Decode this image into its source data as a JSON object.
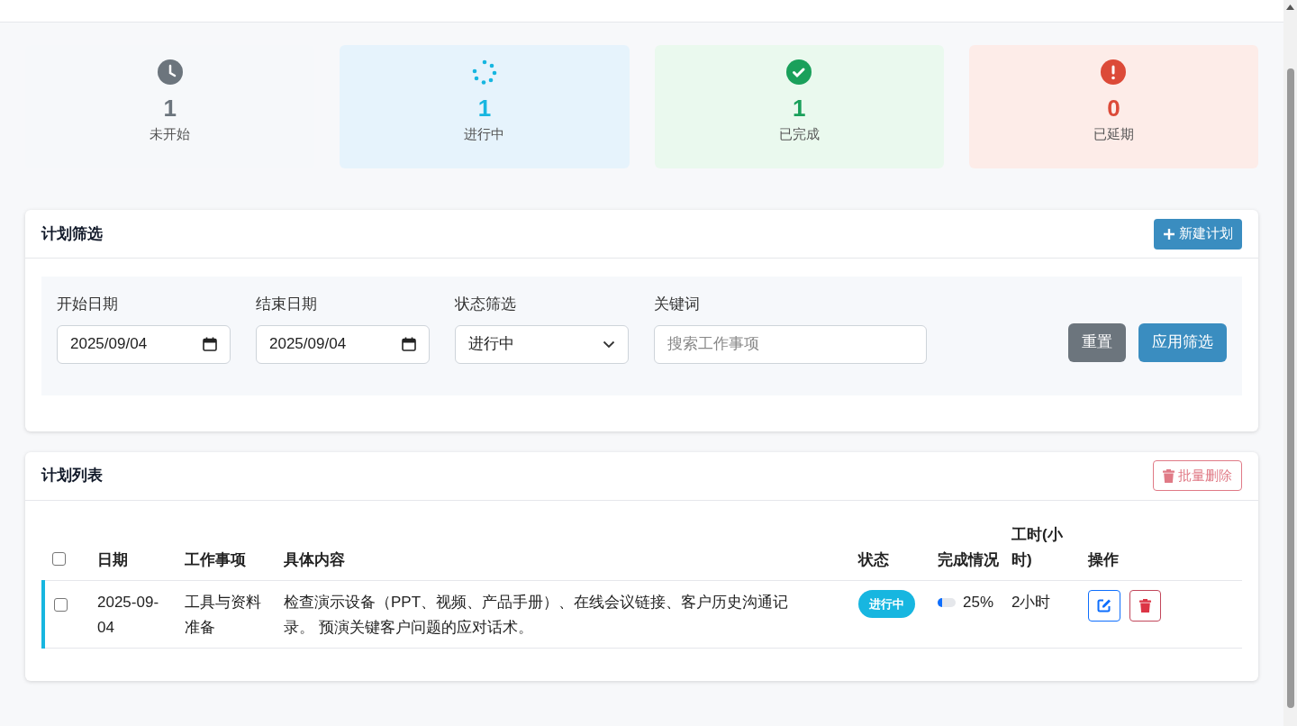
{
  "stats": [
    {
      "kind": "not_started",
      "value": "1",
      "label": "未开始"
    },
    {
      "kind": "in_progress",
      "value": "1",
      "label": "进行中"
    },
    {
      "kind": "done",
      "value": "1",
      "label": "已完成"
    },
    {
      "kind": "delayed",
      "value": "0",
      "label": "已延期"
    }
  ],
  "filter": {
    "title": "计划筛选",
    "new_button": "新建计划",
    "fields": [
      {
        "kind": "date",
        "label": "开始日期",
        "value": "2025/09/04"
      },
      {
        "kind": "date",
        "label": "结束日期",
        "value": "2025/09/04"
      },
      {
        "kind": "select",
        "label": "状态筛选",
        "value": "进行中"
      },
      {
        "kind": "text",
        "label": "关键词",
        "placeholder": "搜索工作事项"
      }
    ],
    "reset_button": "重置",
    "apply_button": "应用筛选"
  },
  "list": {
    "title": "计划列表",
    "batch_delete_button": "批量删除",
    "select_all_checked": false,
    "columns": [
      "日期",
      "工作事项",
      "具体内容",
      "状态",
      "完成情况",
      "工时(小时)",
      "操作"
    ],
    "rows": [
      {
        "checked": false,
        "date": "2025-09-04",
        "item": "工具与资料准备",
        "content": "检查演示设备（PPT、视频、产品手册）、在线会议链接、客户历史沟通记录。 预演关键客户问题的应对话术。",
        "status": "进行中",
        "color": "#17b6e0",
        "level": 0.25,
        "progress": "25%",
        "hours": "2小时"
      }
    ]
  }
}
